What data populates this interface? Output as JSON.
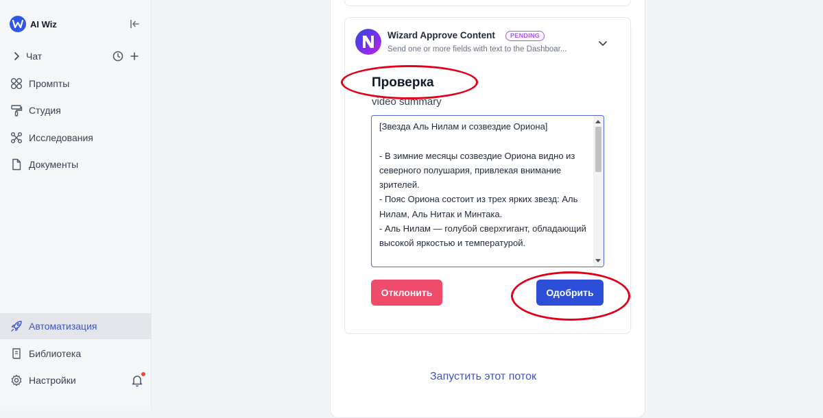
{
  "brand": {
    "name": "AI Wiz",
    "logo_letter": "W",
    "color": "#2f56e6"
  },
  "sidebar": {
    "items": [
      {
        "label": "Чат",
        "icon": "chevron-right-icon"
      },
      {
        "label": "Промпты",
        "icon": "grid-icon"
      },
      {
        "label": "Студия",
        "icon": "paint-roller-icon"
      },
      {
        "label": "Исследования",
        "icon": "molecule-icon"
      },
      {
        "label": "Документы",
        "icon": "document-icon"
      },
      {
        "label": "Автоматизация",
        "icon": "rocket-icon",
        "active": true
      },
      {
        "label": "Библиотека",
        "icon": "book-icon"
      },
      {
        "label": "Настройки",
        "icon": "gear-icon"
      }
    ]
  },
  "card": {
    "title": "Wizard Approve Content",
    "status": "PENDING",
    "subtitle": "Send one or more fields with text to the Dashboar..."
  },
  "review": {
    "heading": "Проверка",
    "field_label": "video summary",
    "text": "[Звезда Аль Нилам и созвездие Ориона]\n\n- В зимние месяцы созвездие Ориона видно из северного полушария, привлекая внимание зрителей.\n- Пояс Ориона состоит из трех ярких звезд: Аль Нилам, Аль Нитак и Минтака.\n- Аль Нилам — голубой сверхгигант, обладающий высокой яркостью и температурой."
  },
  "actions": {
    "reject_label": "Отклонить",
    "approve_label": "Одобрить"
  },
  "footer": {
    "run_label": "Запустить этот поток"
  },
  "colors": {
    "accent": "#2d4fd8",
    "danger": "#ef4b6b",
    "pending": "#a855f7",
    "annotation": "#e0001a"
  }
}
